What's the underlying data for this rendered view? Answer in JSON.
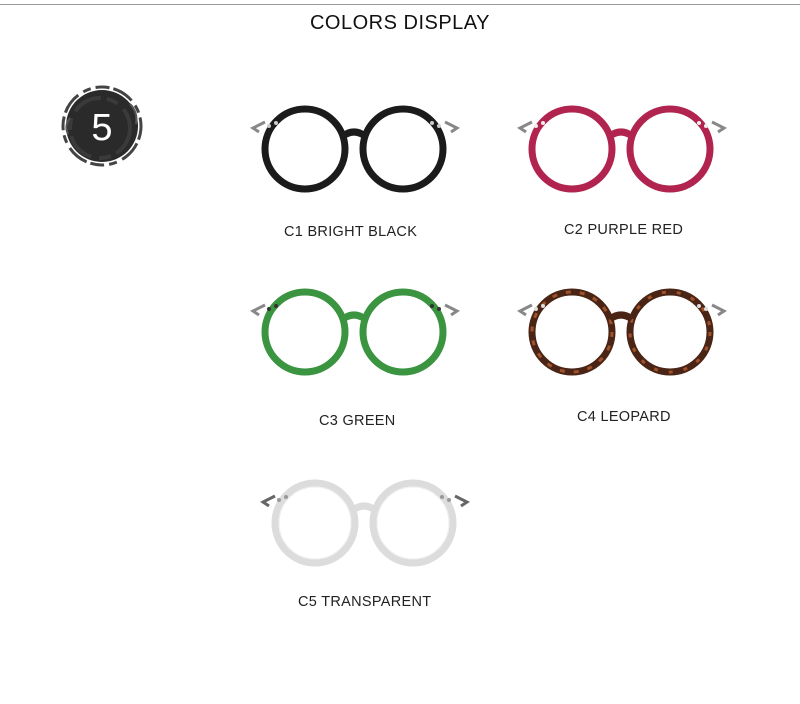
{
  "header": {
    "title": "COLORS DISPLAY"
  },
  "badge": {
    "number": "5"
  },
  "colors": [
    {
      "code": "C1",
      "name": "BRIGHT BLACK",
      "label": "C1 BRIGHT BLACK",
      "frame": "#1b1b1b"
    },
    {
      "code": "C2",
      "name": "PURPLE RED",
      "label": "C2 PURPLE RED",
      "frame": "#b0244f"
    },
    {
      "code": "C3",
      "name": "GREEN",
      "label": "C3 GREEN",
      "frame": "#3a9440"
    },
    {
      "code": "C4",
      "name": "LEOPARD",
      "label": "C4 LEOPARD",
      "frame": "#4a2414"
    },
    {
      "code": "C5",
      "name": "TRANSPARENT",
      "label": "C5 TRANSPARENT",
      "frame": "#dcdcdc"
    }
  ]
}
